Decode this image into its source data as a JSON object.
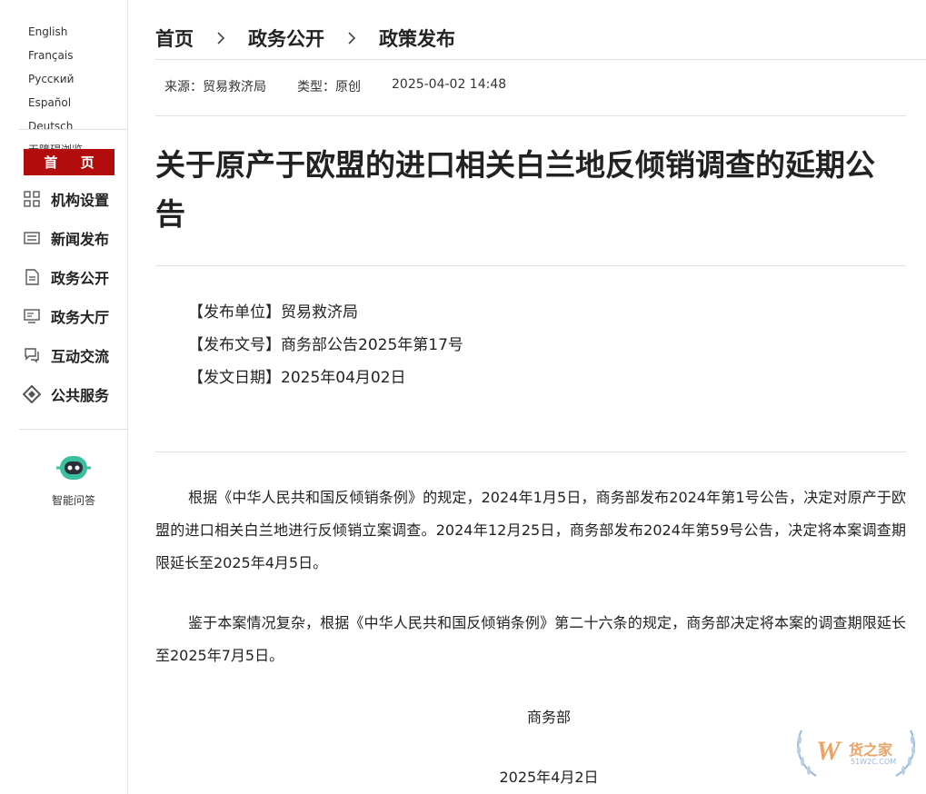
{
  "languages": {
    "row1": [
      "English",
      "Français"
    ],
    "row2": [
      "Русский",
      "Español"
    ],
    "row3": [
      "Deutsch"
    ],
    "accessible": "无障碍浏览"
  },
  "nav": {
    "home": "首 页",
    "items": [
      {
        "label": "机构设置",
        "icon": "org-grid-icon"
      },
      {
        "label": "新闻发布",
        "icon": "news-list-icon"
      },
      {
        "label": "政务公开",
        "icon": "document-icon"
      },
      {
        "label": "政务大厅",
        "icon": "monitor-icon"
      },
      {
        "label": "互动交流",
        "icon": "chat-icon"
      },
      {
        "label": "公共服务",
        "icon": "service-diamond-icon"
      }
    ],
    "assistant": "智能问答"
  },
  "breadcrumb": {
    "items": [
      "首页",
      "政务公开",
      "政策发布"
    ]
  },
  "meta": {
    "source": "来源：贸易救济局",
    "type": "类型：原创",
    "datetime": "2025-04-02 14:48"
  },
  "article": {
    "title": "关于原产于欧盟的进口相关白兰地反倾销调查的延期公告",
    "info": {
      "unit": "【发布单位】贸易救济局",
      "doc_no": "【发布文号】商务部公告2025年第17号",
      "date": "【发文日期】2025年04月02日"
    },
    "paragraphs": [
      "根据《中华人民共和国反倾销条例》的规定，2024年1月5日，商务部发布2024年第1号公告，决定对原产于欧盟的进口相关白兰地进行反倾销立案调查。2024年12月25日，商务部发布2024年第59号公告，决定将本案调查期限延长至2025年4月5日。",
      "鉴于本案情况复杂，根据《中华人民共和国反倾销条例》第二十六条的规定，商务部决定将本案的调查期限延长至2025年7月5日。"
    ],
    "signature": "商务部",
    "sign_date": "2025年4月2日"
  },
  "watermark": {
    "brand": "货之家",
    "site": "51W2C.COM"
  },
  "colors": {
    "accent": "#b20c0c",
    "assistant": "#3bbf9f"
  }
}
